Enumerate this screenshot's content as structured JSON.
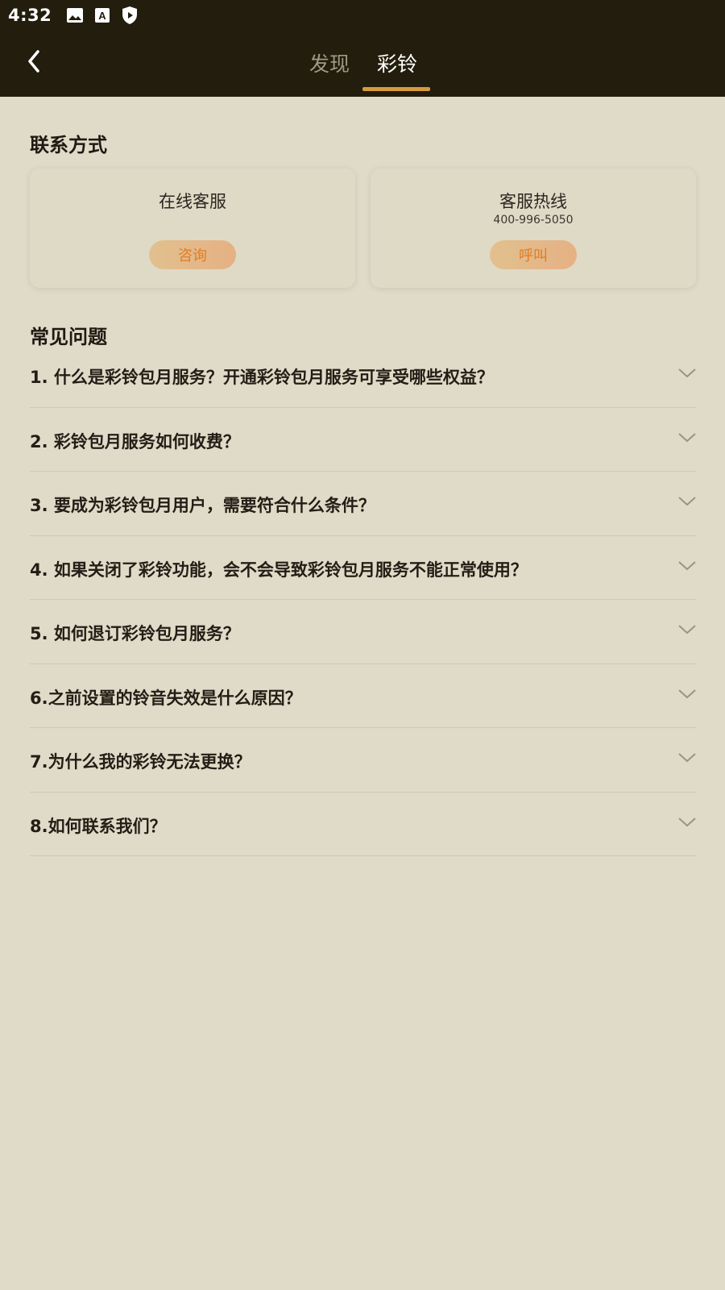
{
  "status_bar": {
    "time": "4:32",
    "icons": [
      "image-icon",
      "font-icon",
      "shield-play-icon"
    ]
  },
  "header": {
    "back_icon": "chevron-left-icon",
    "tabs": [
      {
        "label": "发现",
        "active": false
      },
      {
        "label": "彩铃",
        "active": true
      }
    ],
    "accent_color": "#d69a3e"
  },
  "contact": {
    "title": "联系方式",
    "cards": [
      {
        "title": "在线客服",
        "subtitle": "",
        "button": "咨询"
      },
      {
        "title": "客服热线",
        "subtitle": "400-996-5050",
        "button": "呼叫"
      }
    ]
  },
  "faq": {
    "title": "常见问题",
    "items": [
      {
        "question": "1. 什么是彩铃包月服务？开通彩铃包月服务可享受哪些权益？"
      },
      {
        "question": "2. 彩铃包月服务如何收费？"
      },
      {
        "question": "3. 要成为彩铃包月用户，需要符合什么条件？"
      },
      {
        "question": "4. 如果关闭了彩铃功能，会不会导致彩铃包月服务不能正常使用？"
      },
      {
        "question": "5. 如何退订彩铃包月服务？"
      },
      {
        "question": "6.之前设置的铃音失效是什么原因？"
      },
      {
        "question": "7.为什么我的彩铃无法更换？"
      },
      {
        "question": "8.如何联系我们？"
      }
    ]
  }
}
